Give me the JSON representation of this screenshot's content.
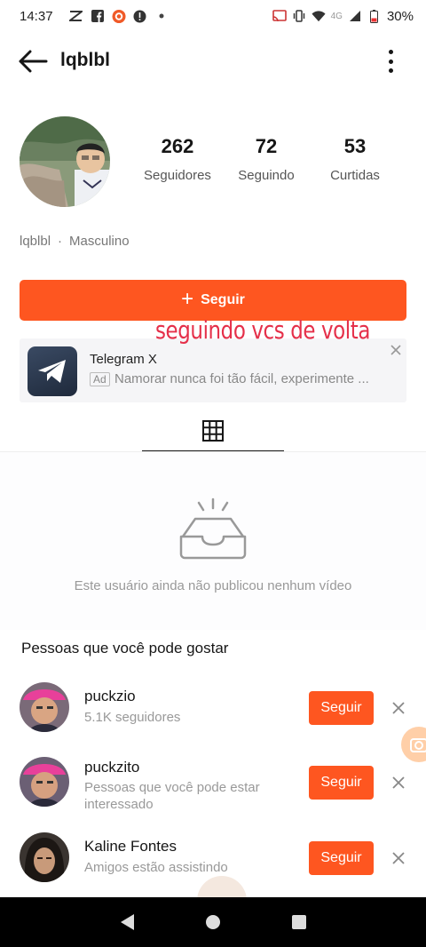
{
  "status_bar": {
    "time": "14:37",
    "network": "4G",
    "battery": "30%"
  },
  "header": {
    "title": "lqblbl"
  },
  "profile": {
    "stats": [
      {
        "value": "262",
        "label": "Seguidores"
      },
      {
        "value": "72",
        "label": "Seguindo"
      },
      {
        "value": "53",
        "label": "Curtidas"
      }
    ],
    "bio_name": "lqblbl",
    "bio_separator": "·",
    "bio_gender": "Masculino",
    "follow_label": "Seguir",
    "overlay_text": "seguindo vcs de volta"
  },
  "ad": {
    "title": "Telegram X",
    "tag": "Ad",
    "description": "Namorar nunca foi tão fácil, experimente ..."
  },
  "empty_state": {
    "text": "Este usuário ainda não publicou nenhum vídeo"
  },
  "suggestions": {
    "title": "Pessoas que você pode gostar",
    "button_label": "Seguir",
    "people": [
      {
        "name": "puckzio",
        "subtitle": "5.1K seguidores"
      },
      {
        "name": "puckzito",
        "subtitle": "Pessoas que você pode estar interessado"
      },
      {
        "name": "Kaline Fontes",
        "subtitle": "Amigos estão assistindo"
      }
    ]
  },
  "colors": {
    "accent": "#fe5620",
    "overlay_text": "#e5304a"
  }
}
